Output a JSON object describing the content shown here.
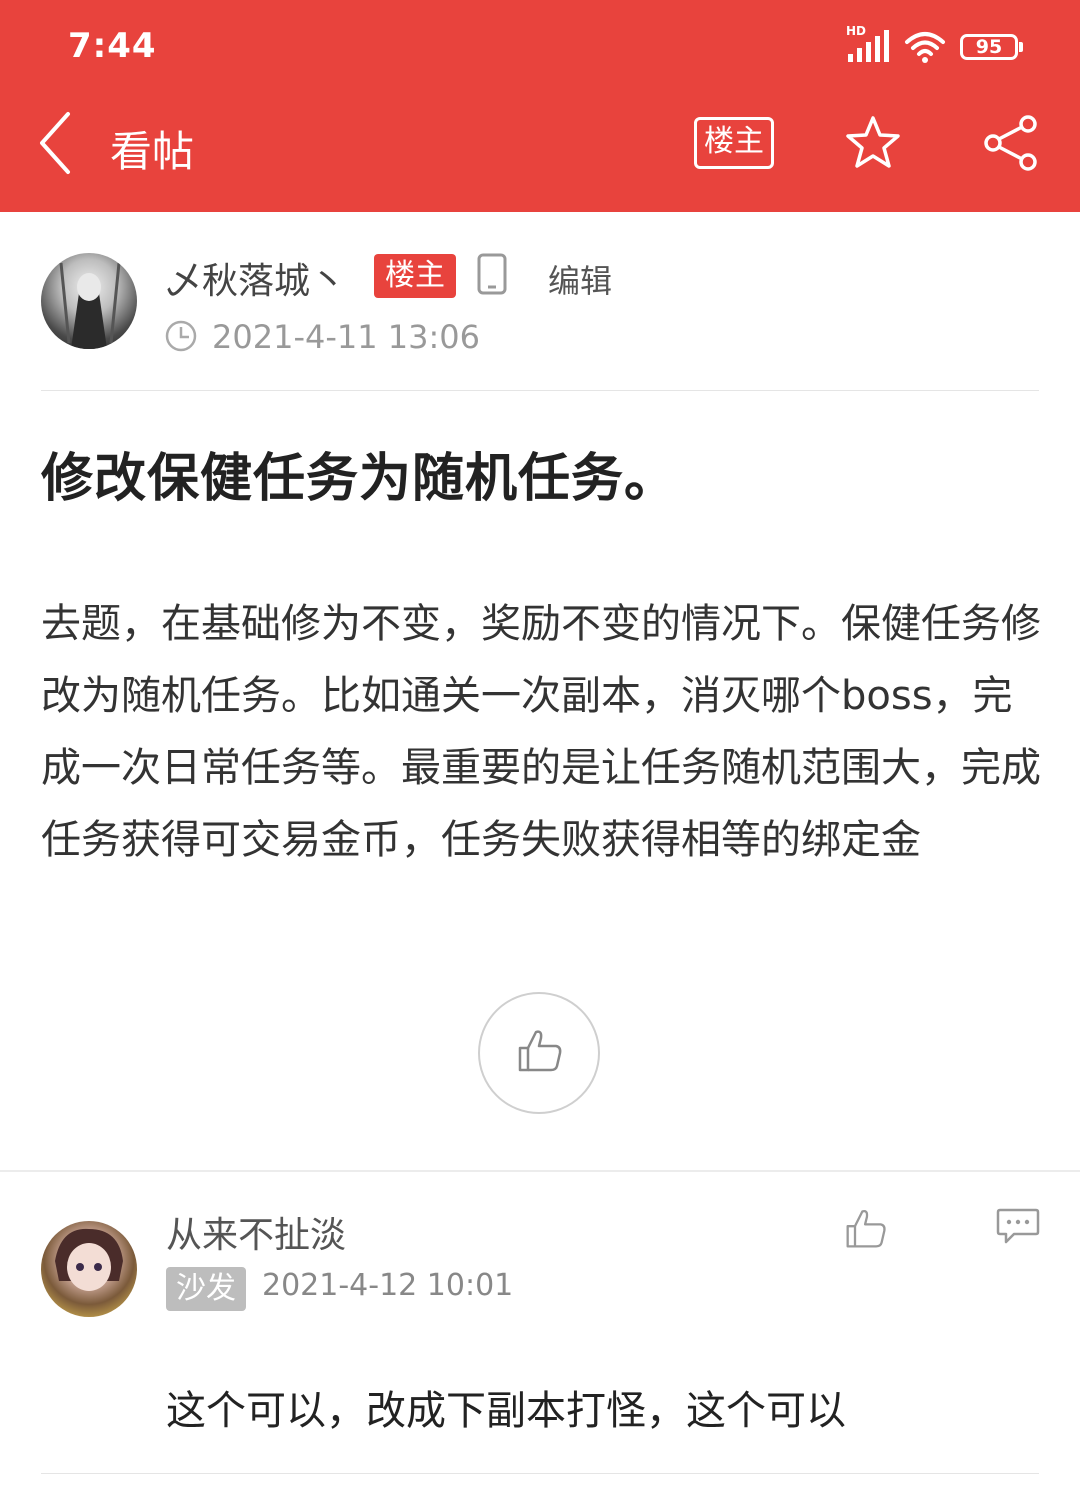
{
  "status_bar": {
    "time": "7:44",
    "network": "HD",
    "battery": "95"
  },
  "nav": {
    "title": "看帖",
    "op_button": "楼主",
    "icons": [
      "back-arrow-icon",
      "star-icon",
      "share-icon"
    ]
  },
  "post": {
    "author": "乄秋落城丶",
    "op_badge": "楼主",
    "edit_label": "编辑",
    "time": "2021-4-11 13:06",
    "title": "修改保健任务为随机任务。",
    "body": "去题，在基础修为不变，奖励不变的情况下。保健任务修改为随机任务。比如通关一次副本，消灭哪个boss，完成一次日常任务等。最重要的是让任务随机范围大，完成任务获得可交易金币，任务失败获得相等的绑定金"
  },
  "reply": {
    "author": "从来不扯淡",
    "badge": "沙发",
    "time": "2021-4-12 10:01",
    "text": "这个可以，改成下副本打怪，这个可以"
  },
  "colors": {
    "brand": "#e8433d",
    "sofa_badge": "#bdbdbd"
  }
}
